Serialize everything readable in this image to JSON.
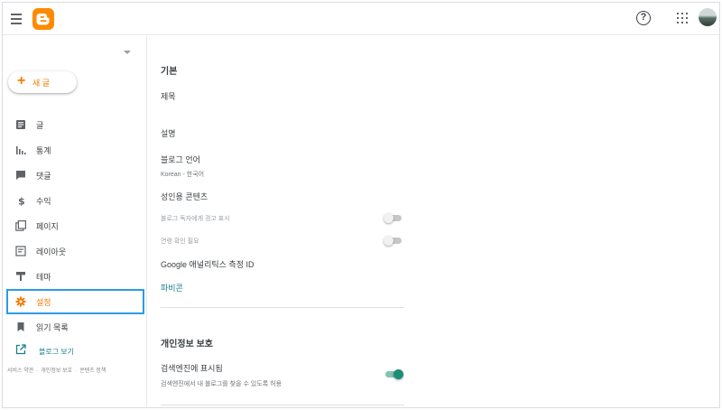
{
  "topbar": {
    "menu_icon": "hamburger-menu-icon",
    "logo_icon": "blogger-logo-icon",
    "help_icon": "help-circle-icon",
    "help_glyph": "?",
    "apps_icon": "apps-grid-icon",
    "avatar_icon": "account-avatar-icon"
  },
  "sidebar": {
    "new_post": {
      "plus": "+",
      "label": "새 글"
    },
    "items": [
      {
        "label": "글",
        "icon": "posts-icon"
      },
      {
        "label": "통계",
        "icon": "stats-icon"
      },
      {
        "label": "댓글",
        "icon": "comments-icon"
      },
      {
        "label": "수익",
        "icon": "earnings-icon"
      },
      {
        "label": "페이지",
        "icon": "pages-icon"
      },
      {
        "label": "레이아웃",
        "icon": "layout-icon"
      },
      {
        "label": "테마",
        "icon": "theme-icon"
      },
      {
        "label": "설정",
        "icon": "settings-gear-icon",
        "active": true
      },
      {
        "label": "읽기 목록",
        "icon": "reading-list-icon"
      }
    ],
    "view_blog": "블로그 보기",
    "footer": {
      "terms": "서비스 약관",
      "privacy": "개인정보 보호",
      "content_policy": "콘텐츠 정책",
      "separator": "·"
    }
  },
  "settings": {
    "basic": {
      "title": "기본",
      "blog_title_label": "제목",
      "description_label": "설명",
      "language_label": "블로그 언어",
      "language_value": "Korean - 한국어",
      "adult_content_label": "성인용 콘텐츠",
      "reader_warning_label": "블로그 독자에게 경고 표시",
      "reader_warning_on": false,
      "age_check_label": "연령 확인 필요",
      "age_check_on": false,
      "analytics_label": "Google 애널리틱스 측정 ID",
      "favicon_label": "파비콘"
    },
    "privacy": {
      "title": "개인정보 보호",
      "search_visible_label": "검색엔진에 표시됨",
      "search_visible_desc": "검색엔진에서 내 블로그를 찾을 수 있도록 허용",
      "search_visible_on": true
    }
  },
  "colors": {
    "accent": "#f57c00",
    "link": "#1a7f8e",
    "focus_outline": "#2d9be6",
    "toggle_on": "#1f8e76"
  }
}
